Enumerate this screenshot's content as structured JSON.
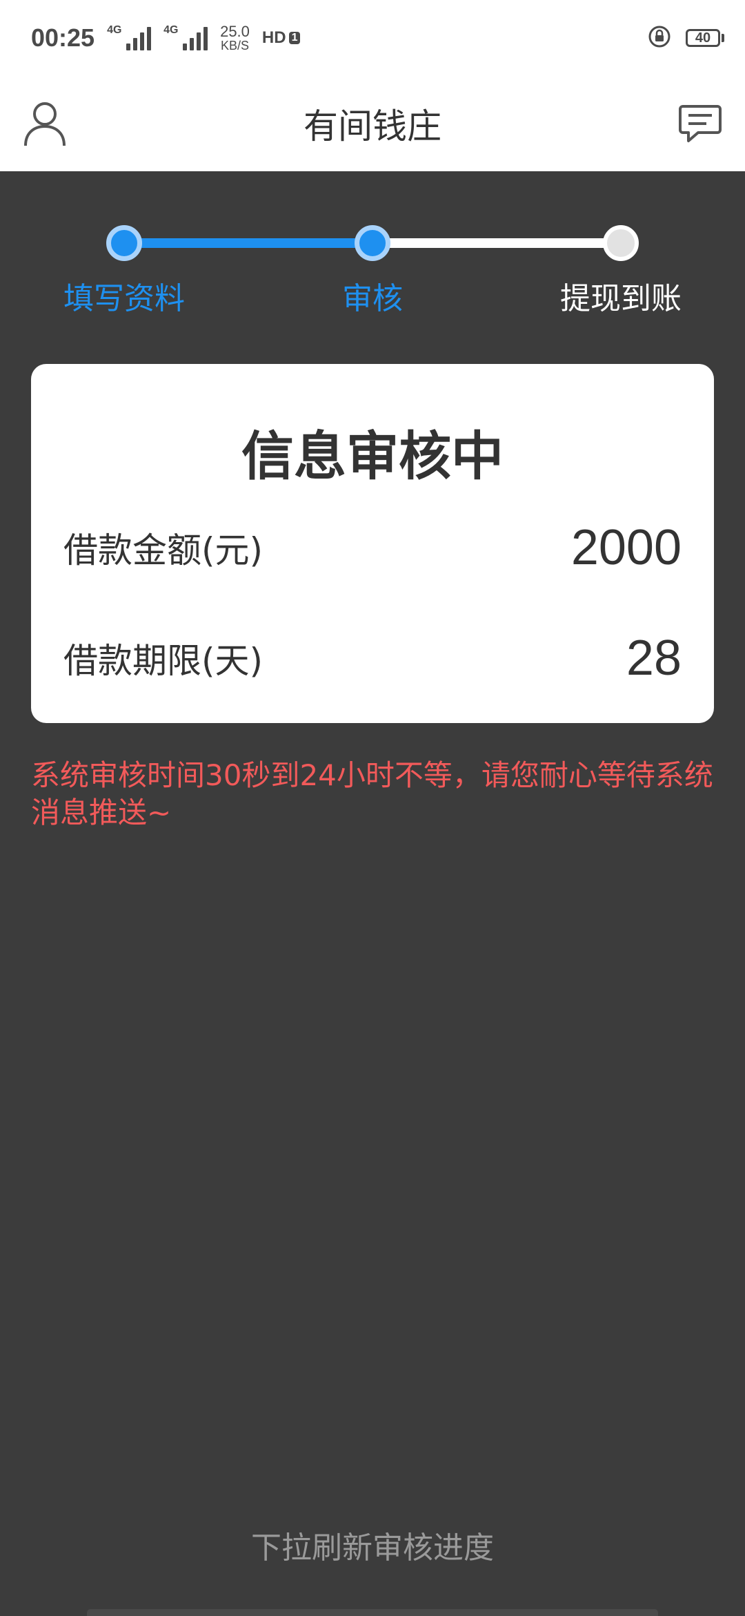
{
  "status_bar": {
    "time": "00:25",
    "signal_1": "4G",
    "signal_2": "4G",
    "net_speed": "25.0",
    "net_unit": "KB/S",
    "hd_label": "HD",
    "hd_sub": "1",
    "battery": "40"
  },
  "app_bar": {
    "title": "有间钱庄"
  },
  "steps": {
    "items": [
      {
        "label": "填写资料",
        "state": "done"
      },
      {
        "label": "审核",
        "state": "done"
      },
      {
        "label": "提现到账",
        "state": "todo"
      }
    ]
  },
  "card": {
    "title": "信息审核中",
    "rows": [
      {
        "label": "借款金额(元)",
        "value": "2000"
      },
      {
        "label": "借款期限(天)",
        "value": "28"
      }
    ]
  },
  "notice": "系统审核时间30秒到24小时不等，请您耐心等待系统消息推送~",
  "refresh_hint": "下拉刷新审核进度",
  "colors": {
    "accent": "#1e90f0",
    "warning": "#f25a5a",
    "background": "#3c3c3c"
  }
}
